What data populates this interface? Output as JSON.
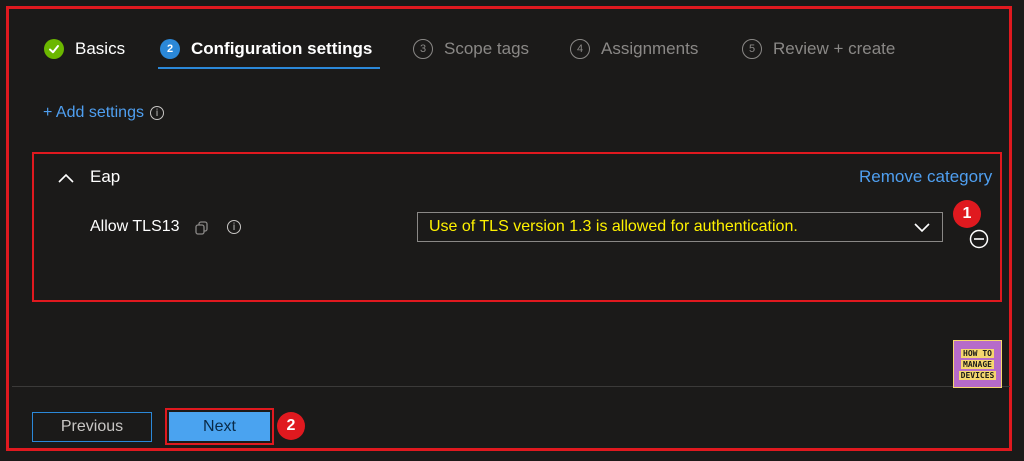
{
  "wizard": {
    "steps": [
      {
        "number": "",
        "label": "Basics",
        "state": "done"
      },
      {
        "number": "2",
        "label": "Configuration settings",
        "state": "active"
      },
      {
        "number": "3",
        "label": "Scope tags",
        "state": "pending"
      },
      {
        "number": "4",
        "label": "Assignments",
        "state": "pending"
      },
      {
        "number": "5",
        "label": "Review + create",
        "state": "pending"
      }
    ]
  },
  "add_settings": {
    "label": "+ Add settings",
    "info_glyph": "i"
  },
  "category": {
    "title": "Eap",
    "remove_label": "Remove category",
    "setting": {
      "label": "Allow TLS13",
      "info_glyph": "i",
      "selected_value": "Use of TLS version 1.3 is allowed for authentication."
    }
  },
  "annotations": {
    "badge_1": "1",
    "badge_2": "2"
  },
  "footer": {
    "previous_label": "Previous",
    "next_label": "Next"
  },
  "logo": {
    "line1": "HOW TO",
    "line2": "MANAGE",
    "line3": "DEVICES"
  },
  "colors": {
    "background": "#1b1a19",
    "accent": "#2b88d8",
    "link": "#4f9ff0",
    "highlight_box": "#e0191f",
    "done_check": "#6bb700",
    "value_text": "#fff200"
  }
}
